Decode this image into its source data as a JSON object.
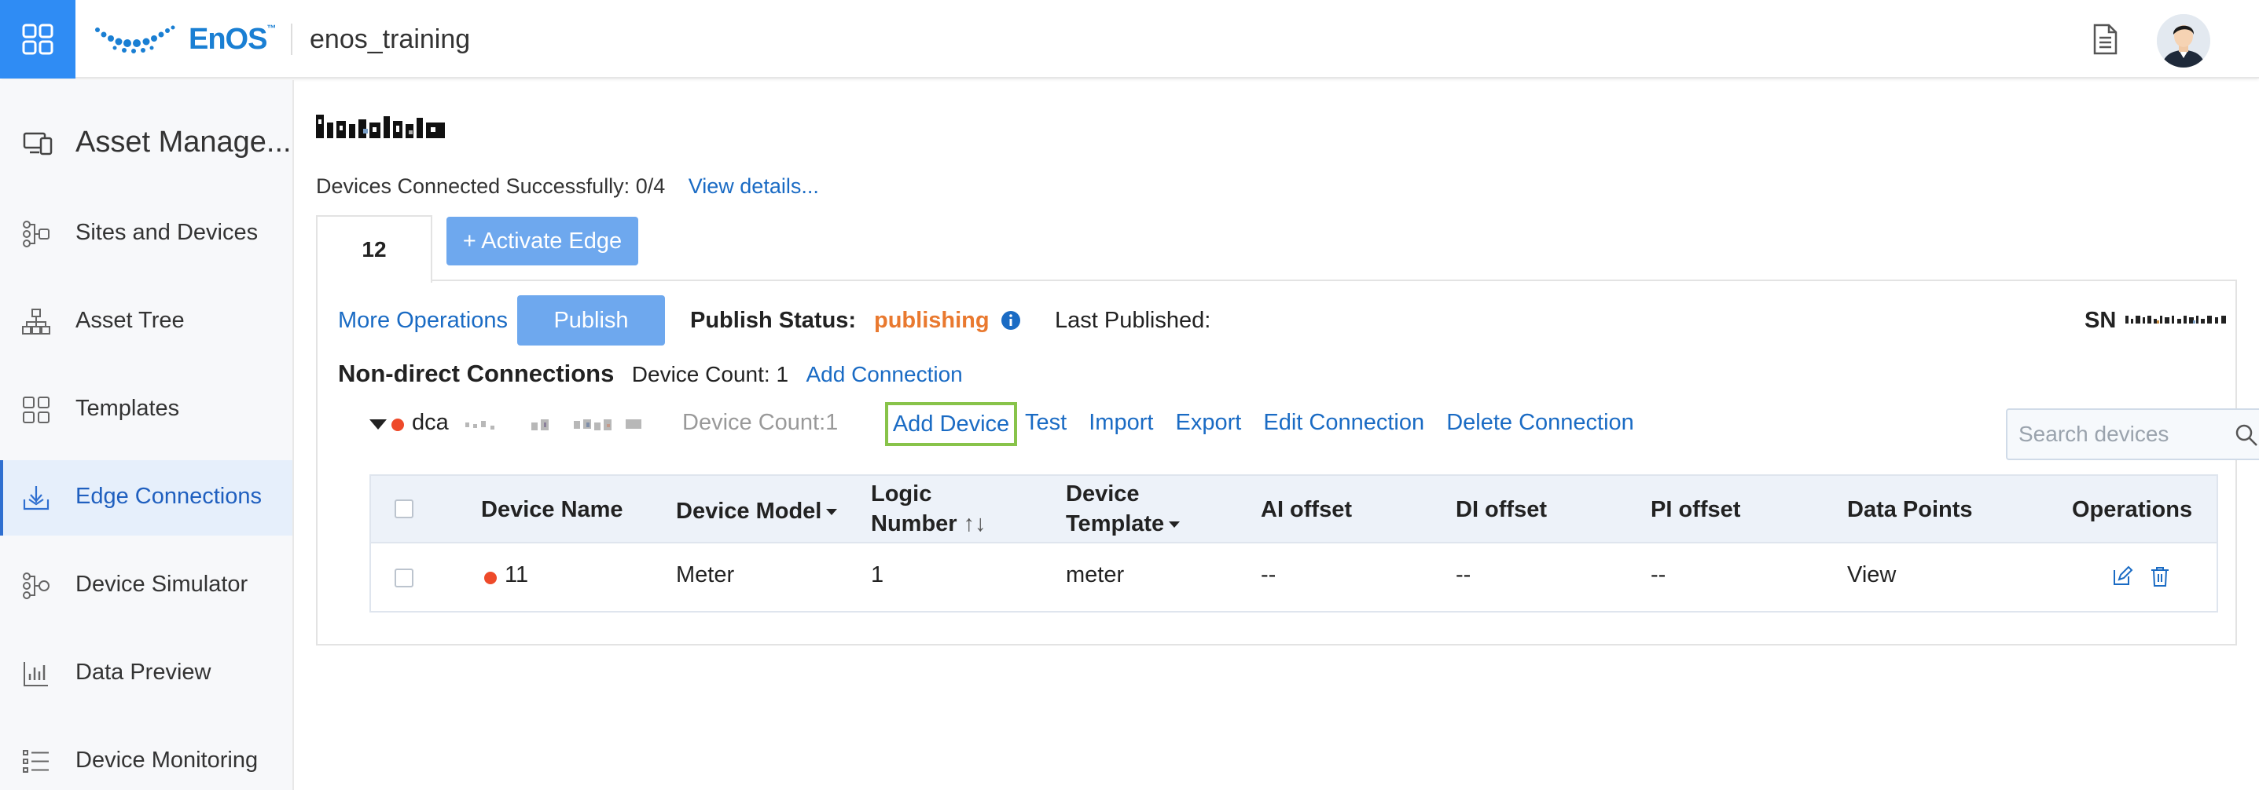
{
  "header": {
    "logo_text": "EnOS",
    "logo_tm": "™",
    "org_name": "enos_training"
  },
  "sidebar": {
    "title": "Asset Manage...",
    "items": [
      {
        "label": "Sites and Devices",
        "icon": "sites-devices-icon"
      },
      {
        "label": "Asset Tree",
        "icon": "asset-tree-icon"
      },
      {
        "label": "Templates",
        "icon": "templates-icon"
      },
      {
        "label": "Edge Connections",
        "icon": "edge-connections-icon",
        "active": true
      },
      {
        "label": "Device Simulator",
        "icon": "device-simulator-icon"
      },
      {
        "label": "Data Preview",
        "icon": "data-preview-icon"
      },
      {
        "label": "Device Monitoring",
        "icon": "device-monitoring-icon"
      }
    ]
  },
  "main": {
    "connected_text": "Devices Connected Successfully: 0/4",
    "view_details": "View details...",
    "tab_label": "12",
    "activate_edge": "+ Activate Edge",
    "more_operations": "More Operations",
    "publish": "Publish",
    "publish_status_label": "Publish Status:",
    "publish_status_value": "publishing",
    "last_published_label": "Last Published:",
    "sn_label": "SN",
    "non_direct_title": "Non-direct Connections",
    "device_count": "Device Count: 1",
    "add_connection": "Add Connection",
    "connection": {
      "name": "dca",
      "device_count": "Device Count:1",
      "add_device": "Add Device",
      "test": "Test",
      "import": "Import",
      "export": "Export",
      "edit_connection": "Edit Connection",
      "delete_connection": "Delete Connection"
    },
    "search_placeholder": "Search devices"
  },
  "table": {
    "columns": {
      "device_name": "Device Name",
      "device_model": "Device Model",
      "logic_number_1": "Logic",
      "logic_number_2": "Number",
      "logic_sort": "↑↓",
      "device_template_1": "Device",
      "device_template_2": "Template",
      "ai_offset": "AI offset",
      "di_offset": "DI offset",
      "pi_offset": "PI offset",
      "data_points": "Data Points",
      "operations": "Operations"
    },
    "rows": [
      {
        "device_name": "11",
        "device_model": "Meter",
        "logic_number": "1",
        "device_template": "meter",
        "ai_offset": "--",
        "di_offset": "--",
        "pi_offset": "--",
        "data_points": "View"
      }
    ]
  },
  "colors": {
    "primary": "#2f8cf4",
    "button": "#6ea8ee",
    "link": "#1a6bc4",
    "publishing": "#e9792f",
    "status_dot": "#ee4a2a",
    "highlight_border": "#88c34a"
  }
}
